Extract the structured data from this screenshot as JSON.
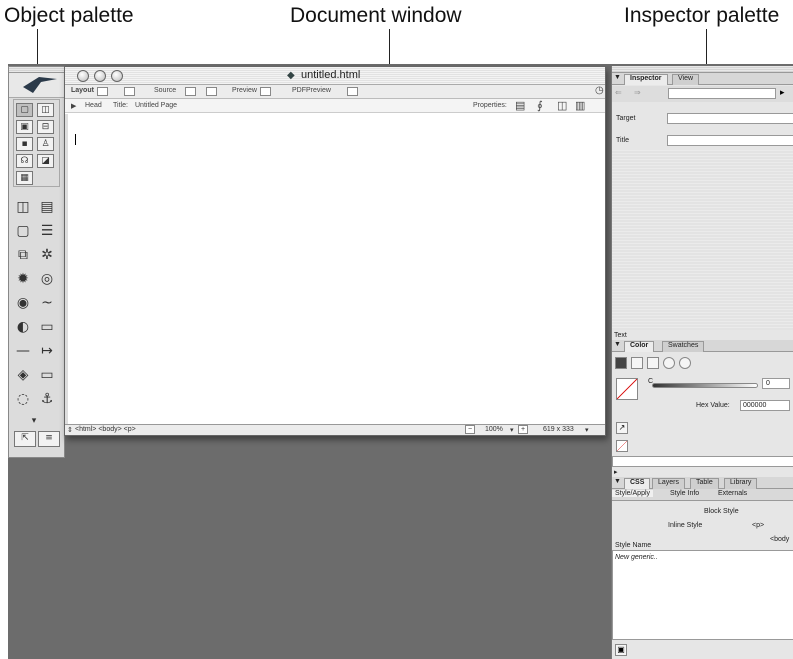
{
  "callouts": {
    "object_palette": "Object palette",
    "document_window": "Document window",
    "inspector_palette": "Inspector palette"
  },
  "document": {
    "filename": "untitled.html",
    "tabs": [
      "Layout",
      "Source",
      "Preview",
      "PDFPreview"
    ],
    "head_label": "Head",
    "title_label": "Title:",
    "title_value": "Untitled Page",
    "properties_label": "Properties:",
    "status_tags": "<html> <body> <p>",
    "zoom": "100%",
    "size": "619 x 333"
  },
  "inspector": {
    "tabs": [
      "Inspector",
      "View"
    ],
    "target_label": "Target",
    "title_label": "Title",
    "footer_label": "Text"
  },
  "color": {
    "tabs": [
      "Color",
      "Swatches"
    ],
    "c_label": "C",
    "c_value": "0",
    "hex_label": "Hex Value:",
    "hex_value": "000000"
  },
  "css": {
    "tabs": [
      "CSS",
      "Layers",
      "Table",
      "Library"
    ],
    "subtabs": [
      "Style/Apply",
      "Style Info",
      "Externals"
    ],
    "block_style": "Block Style",
    "inline_style": "Inline Style",
    "p_tag": "<p>",
    "body_tag": "<body",
    "style_name_header": "Style Name",
    "new_generic": "New  generic.."
  }
}
